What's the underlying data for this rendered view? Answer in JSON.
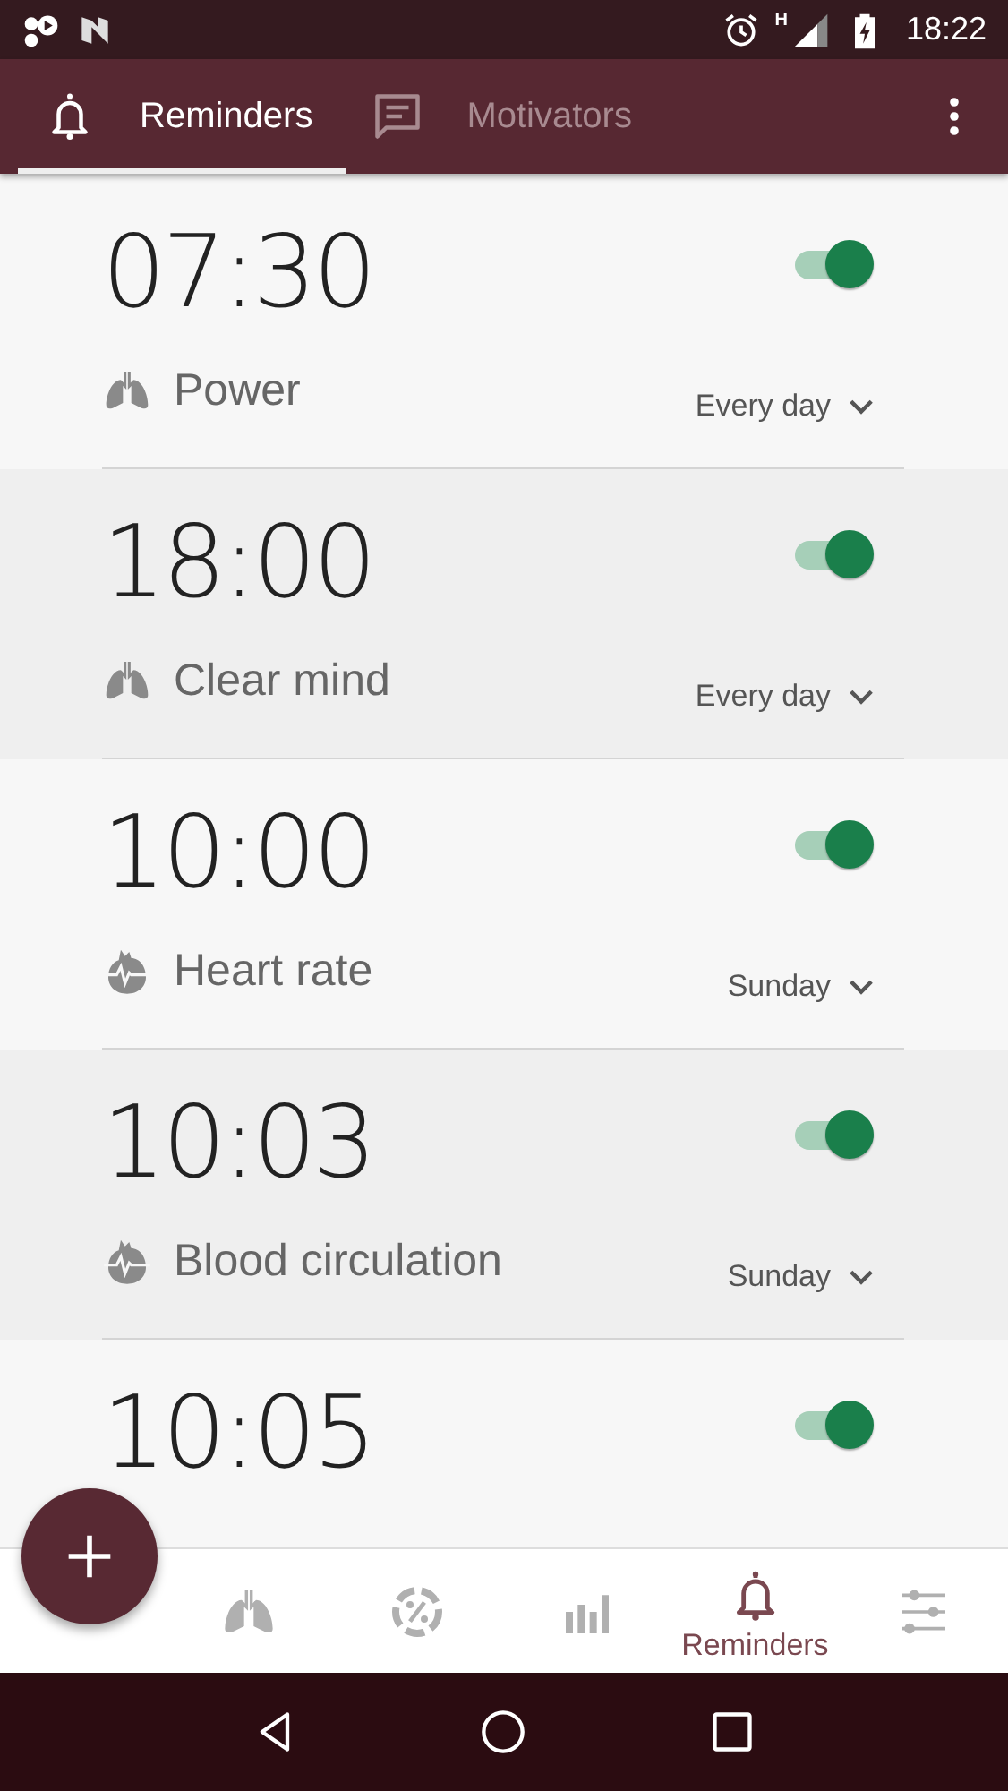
{
  "status_bar": {
    "time": "18:22",
    "network": "H"
  },
  "tabs": [
    {
      "label": "Reminders",
      "kind": "bell",
      "selected": true
    },
    {
      "label": "Motivators",
      "kind": "message",
      "selected": false
    }
  ],
  "reminders": [
    {
      "time": "07:30",
      "on": true,
      "kind": "lungs",
      "label": "Power",
      "repeat": "Every day"
    },
    {
      "time": "18:00",
      "on": true,
      "kind": "lungs",
      "label": "Clear mind",
      "repeat": "Every day"
    },
    {
      "time": "10:00",
      "on": true,
      "kind": "heart",
      "label": "Heart rate",
      "repeat": "Sunday"
    },
    {
      "time": "10:03",
      "on": true,
      "kind": "heart",
      "label": "Blood circulation",
      "repeat": "Sunday"
    },
    {
      "time": "10:05",
      "on": true
    }
  ],
  "bottom_nav": [
    {
      "kind": "lungs",
      "selected": false
    },
    {
      "kind": "percent",
      "selected": false
    },
    {
      "kind": "chart",
      "selected": false
    },
    {
      "kind": "bell",
      "label": "Reminders",
      "selected": true
    },
    {
      "kind": "sliders",
      "selected": false
    }
  ]
}
